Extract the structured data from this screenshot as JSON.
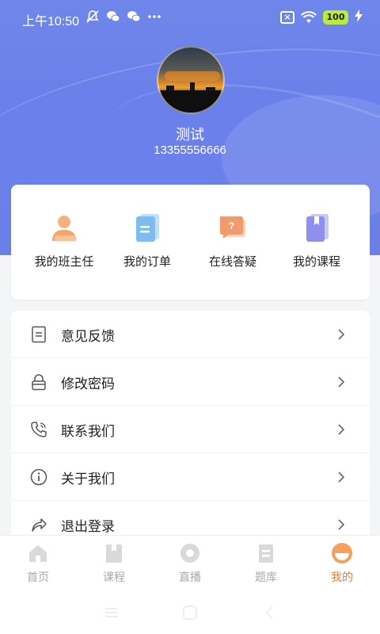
{
  "status_bar": {
    "time": "上午10:50",
    "battery": "100"
  },
  "profile": {
    "name": "测试",
    "phone": "13355556666"
  },
  "quick_actions": [
    {
      "label": "我的班主任",
      "icon": "teacher-icon",
      "color": "#f4a56b"
    },
    {
      "label": "我的订单",
      "icon": "order-icon",
      "color": "#7cbcf0"
    },
    {
      "label": "在线答疑",
      "icon": "qa-icon",
      "color": "#f39a6c"
    },
    {
      "label": "我的课程",
      "icon": "course-icon",
      "color": "#8f8ff0"
    }
  ],
  "menu": [
    {
      "label": "意见反馈",
      "icon": "feedback-icon"
    },
    {
      "label": "修改密码",
      "icon": "lock-icon"
    },
    {
      "label": "联系我们",
      "icon": "phone-icon"
    },
    {
      "label": "关于我们",
      "icon": "info-icon"
    },
    {
      "label": "退出登录",
      "icon": "logout-icon"
    }
  ],
  "tabs": [
    {
      "label": "首页",
      "icon": "home-icon",
      "active": false
    },
    {
      "label": "课程",
      "icon": "course-tab-icon",
      "active": false
    },
    {
      "label": "直播",
      "icon": "live-icon",
      "active": false
    },
    {
      "label": "题库",
      "icon": "question-bank-icon",
      "active": false
    },
    {
      "label": "我的",
      "icon": "profile-icon",
      "active": true
    }
  ],
  "colors": {
    "header": "#6b80ea",
    "accent": "#f07b26",
    "tab_inactive": "#a8a8a8"
  }
}
